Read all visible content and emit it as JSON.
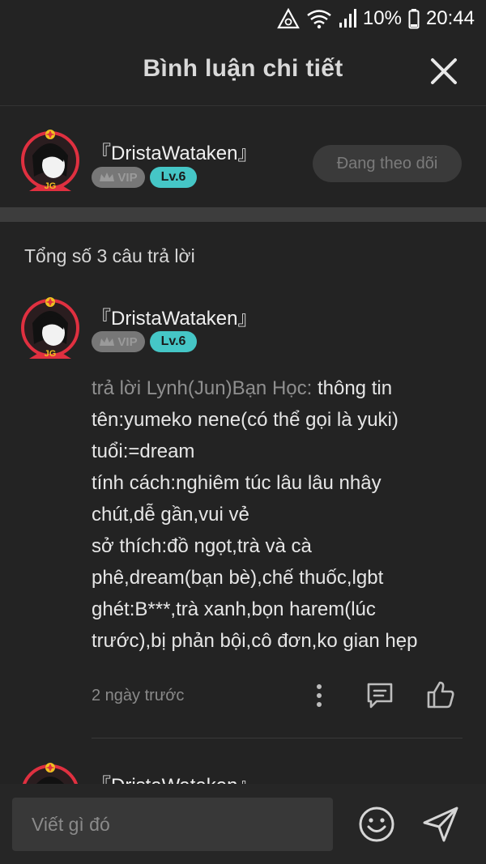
{
  "status_bar": {
    "battery": "10%",
    "time": "20:44"
  },
  "header": {
    "title": "Bình luận chi tiết"
  },
  "author": {
    "name": "『DristaWataken』",
    "vip_label": "VIP",
    "level": "Lv.6",
    "follow_label": "Đang theo dõi",
    "avatar_label": "JG"
  },
  "replies": {
    "total_label": "Tổng số 3 câu trả lời"
  },
  "comment": {
    "name": "『DristaWataken』",
    "vip_label": "VIP",
    "level": "Lv.6",
    "reply_prefix": "trả lời Lynh(Jun)Bạn Học:",
    "lines": [
      " thông tin",
      "tên:yumeko nene(có thể gọi là yuki)",
      "tuổi:=dream",
      "tính cách:nghiêm túc lâu lâu nhây",
      "chút,dễ gần,vui vẻ",
      "sở thích:đồ ngọt,trà và cà",
      "phê,dream(bạn bè),chế thuốc,lgbt",
      "ghét:B***,trà xanh,bọn harem(lúc",
      "trước),bị phản bội,cô đơn,ko gian hẹp"
    ],
    "time": "2 ngày trước"
  },
  "next_comment": {
    "name": "『DristaWataken』"
  },
  "input": {
    "placeholder": "Viết gì đó"
  },
  "colors": {
    "background": "#232323",
    "level_badge": "#45c6c6",
    "accent_red": "#e03040"
  }
}
